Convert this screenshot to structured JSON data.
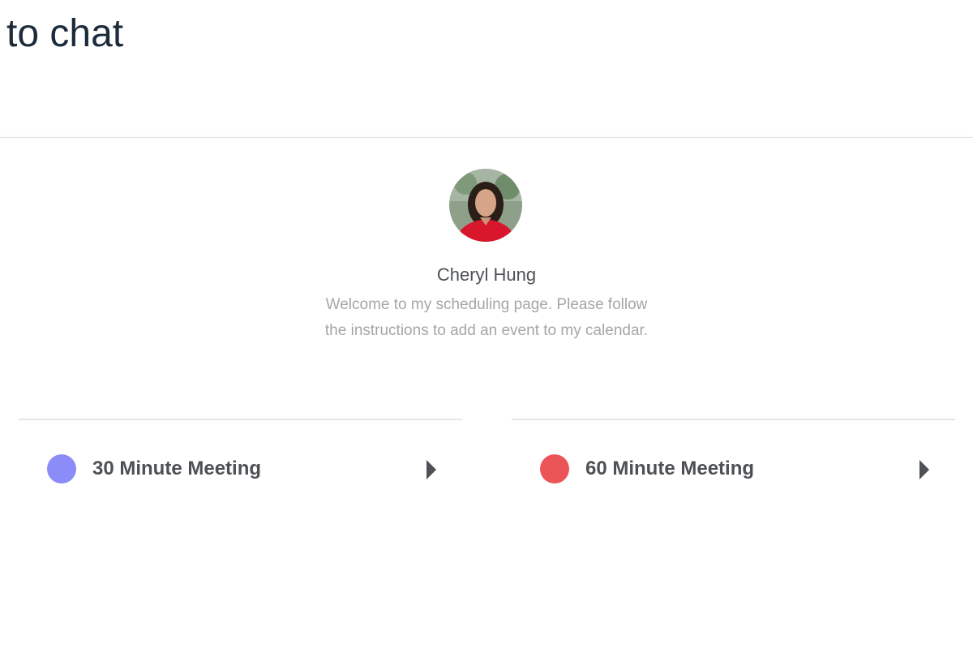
{
  "header": {
    "heading": "to chat"
  },
  "profile": {
    "name": "Cheryl Hung",
    "welcome": "Welcome to my scheduling page. Please follow the instructions to add an event to my calendar."
  },
  "events": [
    {
      "label": "30 Minute Meeting",
      "color": "#8b8cf8",
      "icon": "chevron-right-icon"
    },
    {
      "label": "60 Minute Meeting",
      "color": "#ec5558",
      "icon": "chevron-right-icon"
    }
  ]
}
